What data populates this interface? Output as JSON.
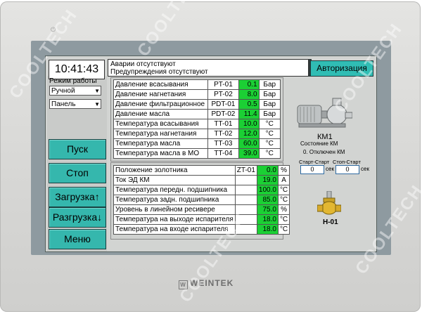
{
  "device": {
    "brand": "WEINTEK"
  },
  "header": {
    "clock": "10:41:43",
    "alarm_line1": "Аварии отсутствуют",
    "alarm_line2": "Предупреждения отсутствуют",
    "auth_label": "Авторизация"
  },
  "left": {
    "mode_label": "Режим работы",
    "mode_value": "Ручной",
    "panel_value": "Панель",
    "buttons": [
      "Пуск",
      "Стоп",
      "Загрузка↑",
      "Разгрузка↓",
      "Меню"
    ]
  },
  "table1": {
    "rows": [
      {
        "name": "Давление всасывания",
        "tag": "PT-01",
        "value": "0.1",
        "unit": "Бар"
      },
      {
        "name": "Давление нагнетания",
        "tag": "PT-02",
        "value": "8.0",
        "unit": "Бар"
      },
      {
        "name": "Давление фильтрационное",
        "tag": "PDT-01",
        "value": "0.5",
        "unit": "Бар"
      },
      {
        "name": "Давление масла",
        "tag": "PDT-02",
        "value": "11.4",
        "unit": "Бар"
      },
      {
        "name": "Температура всасывания",
        "tag": "TT-01",
        "value": "10.0",
        "unit": "°C"
      },
      {
        "name": "Температура нагнетания",
        "tag": "TT-02",
        "value": "12.0",
        "unit": "°C"
      },
      {
        "name": "Температура масла",
        "tag": "TT-03",
        "value": "60.0",
        "unit": "°C"
      },
      {
        "name": "Температура масла в МО",
        "tag": "TT-04",
        "value": "39.0",
        "unit": "°C"
      }
    ]
  },
  "table2": {
    "rows": [
      {
        "name": "Положение золотника",
        "tag": "ZT-01",
        "value": "0.0",
        "unit": "%"
      },
      {
        "name": "Ток ЭД КМ",
        "tag": "",
        "value": "19.0",
        "unit": "A"
      },
      {
        "name": "Температура передн. подшипника",
        "tag": "",
        "value": "100.0",
        "unit": "°C"
      },
      {
        "name": "Температура задн. подшипника",
        "tag": "",
        "value": "85.0",
        "unit": "°C"
      },
      {
        "name": "Уровень в линейном ресивере",
        "tag": "",
        "value": "75.0",
        "unit": "%"
      },
      {
        "name": "Температура на выходе испарителя",
        "tag": "",
        "value": "18.0",
        "unit": "°C"
      },
      {
        "name": "Температура на входе испарителя",
        "tag": "",
        "value": "18.0",
        "unit": "°C"
      }
    ]
  },
  "compressor": {
    "label": "КМ1",
    "state_label": "Состояние КМ",
    "state_value": "0. Отключен КМ",
    "start_start_label": "Старт-Старт",
    "stop_start_label": "Стоп-Старт",
    "start_start_value": "0",
    "stop_start_value": "0",
    "unit": "сек"
  },
  "valve": {
    "label": "Н-01"
  },
  "watermark": "COOLTECH",
  "colors": {
    "accent": "#35b7ad",
    "value_green": "#1bd034"
  }
}
